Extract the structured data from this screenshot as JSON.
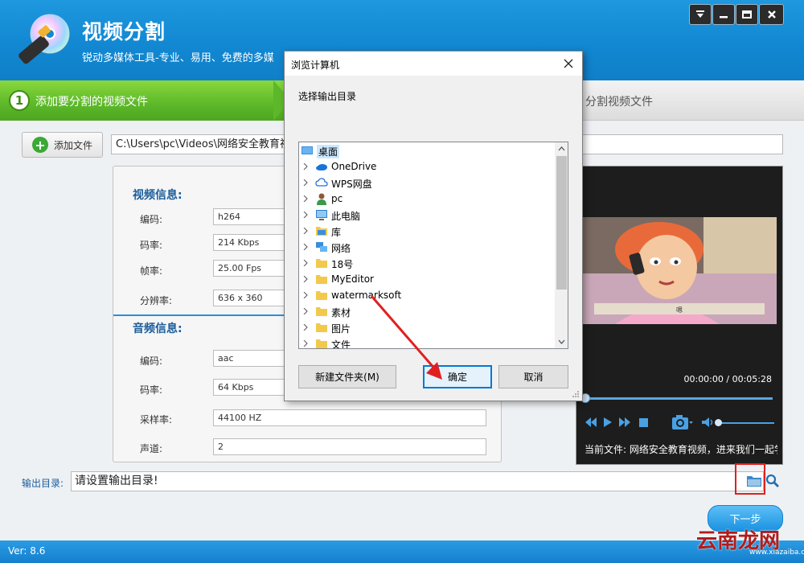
{
  "app": {
    "title": "视频分割",
    "subtitle": "锐动多媒体工具-专业、易用、免费的多媒",
    "version": "Ver: 8.6"
  },
  "steps": {
    "step1_number": "1",
    "step1_label": "添加要分割的视频文件",
    "step3_label": "分割视频文件"
  },
  "file": {
    "add_button_label": "添加文件",
    "path": "C:\\Users\\pc\\Videos\\网络安全教育视"
  },
  "video_info": {
    "title": "视频信息:",
    "rows": [
      {
        "label": "编码:",
        "value": "h264"
      },
      {
        "label": "码率:",
        "value": "214 Kbps"
      },
      {
        "label": "帧率:",
        "value": "25.00 Fps"
      },
      {
        "label": "分辨率:",
        "value": "636 x 360"
      }
    ]
  },
  "audio_info": {
    "title": "音频信息:",
    "rows": [
      {
        "label": "编码:",
        "value": "aac"
      },
      {
        "label": "码率:",
        "value": "64 Kbps"
      },
      {
        "label": "采样率:",
        "value": "44100 HZ"
      },
      {
        "label": "声道:",
        "value": "2"
      }
    ]
  },
  "preview": {
    "subtitle_text": "嗯",
    "time": "00:00:00 / 00:05:28",
    "current_file": "当前文件: 网络安全教育视频，进来我们一起学"
  },
  "output": {
    "label": "输出目录:",
    "placeholder": "请设置输出目录!",
    "next_label": "下一步"
  },
  "dialog": {
    "title": "浏览计算机",
    "prompt": "选择输出目录",
    "root": "桌面",
    "items": [
      "OneDrive",
      "WPS网盘",
      "pc",
      "此电脑",
      "库",
      "网络",
      "18号",
      "MyEditor",
      "watermarksoft",
      "素材",
      "图片",
      "文件"
    ],
    "new_folder_label": "新建文件夹(M)",
    "ok_label": "确定",
    "cancel_label": "取消"
  },
  "watermark": {
    "brand": "云南龙网",
    "url": "www.xiazaiba.com"
  },
  "colors": {
    "header_blue": "#1288d2",
    "step_green": "#5cb82a",
    "highlight_red": "#e02020",
    "dialog_accent": "#0078d7"
  }
}
